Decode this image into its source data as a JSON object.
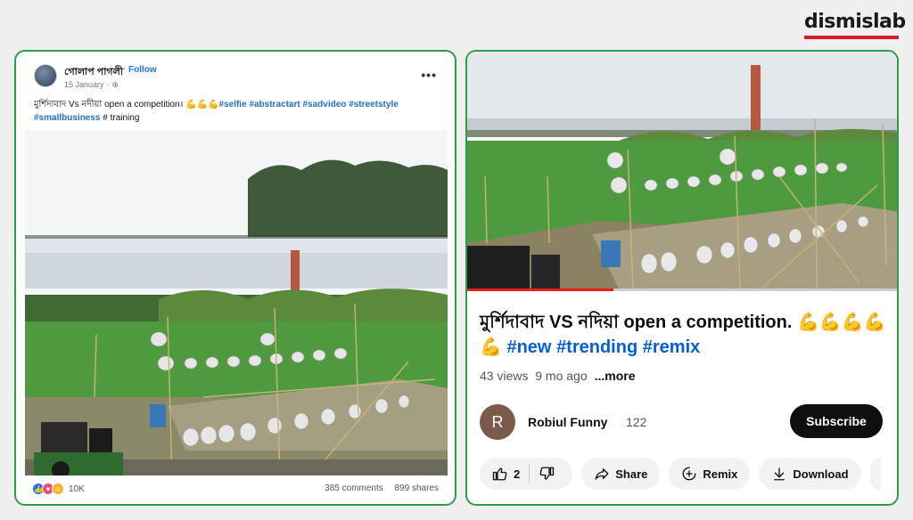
{
  "brand": {
    "name": "dismislab",
    "accent": "#d11a2a"
  },
  "facebook": {
    "author": "গোলাপ পাগলী",
    "follow_label": "Follow",
    "date": "15 January",
    "caption_text": "মুর্শিদাবাদ Vs নদীয়া open a competition। 💪💪💪",
    "hashtags_line1": [
      "#selfie",
      "#abstractart",
      "#sadvideo",
      "#streetstyle"
    ],
    "hashtags_line2": [
      "#smallbusiness"
    ],
    "caption_tail": "# training",
    "reaction_count": "10K",
    "comments": "385 comments",
    "shares": "899 shares"
  },
  "youtube": {
    "title_text": "মুর্শিদাবাদ VS নদিয়া open a competition. 💪💪💪💪💪",
    "hashtags": [
      "#new",
      "#trending",
      "#remix"
    ],
    "views": "43 views",
    "age": "9 mo ago",
    "more_label": "...more",
    "channel_initial": "R",
    "channel_name": "Robiul Funny",
    "subscriber_count": "122",
    "subscribe_label": "Subscribe",
    "like_count": "2",
    "share_label": "Share",
    "remix_label": "Remix",
    "download_label": "Download",
    "progress_fraction": 0.34
  },
  "colors": {
    "card_border": "#2e9d49",
    "fb_link": "#1f6fc4",
    "yt_link": "#065fd4",
    "yt_progress": "#e62117"
  }
}
